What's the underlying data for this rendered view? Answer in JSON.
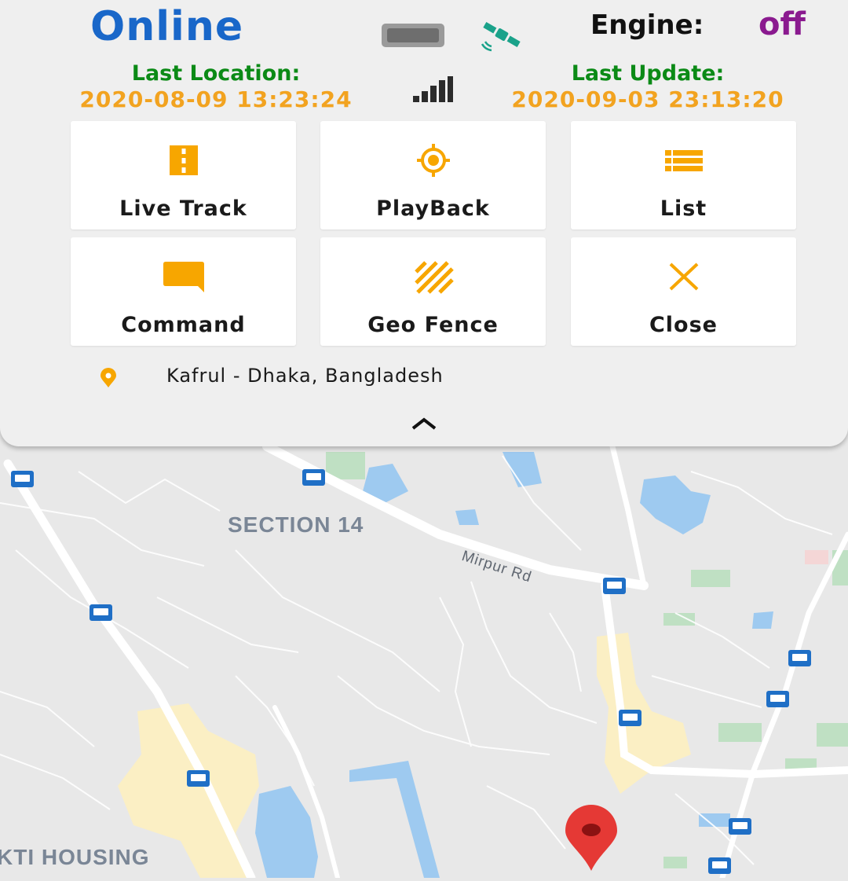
{
  "header": {
    "status": "Online",
    "engine_label": "Engine:",
    "engine_value": "off",
    "last_location_label": "Last Location:",
    "last_location_value": "2020-08-09 13:23:24",
    "last_update_label": "Last Update:",
    "last_update_value": "2020-09-03 23:13:20"
  },
  "actions": [
    {
      "label": "Live Track",
      "icon": "road-icon"
    },
    {
      "label": "PlayBack",
      "icon": "crosshair-icon"
    },
    {
      "label": "List",
      "icon": "list-icon"
    },
    {
      "label": "Command",
      "icon": "message-icon"
    },
    {
      "label": "Geo Fence",
      "icon": "striped-area-icon"
    },
    {
      "label": "Close",
      "icon": "close-icon"
    }
  ],
  "address": "Kafrul - Dhaka, Bangladesh",
  "map": {
    "labels": {
      "area_1": "SECTION 14",
      "road_1": "Mirpur Rd",
      "area_2": "KTI HOUSING"
    }
  },
  "colors": {
    "status": "#1967c9",
    "accent": "#f7a600",
    "label_green": "#0b8a16",
    "value_orange": "#f2a320",
    "engine_off": "#8a1a8f",
    "marker": "#e53935"
  }
}
